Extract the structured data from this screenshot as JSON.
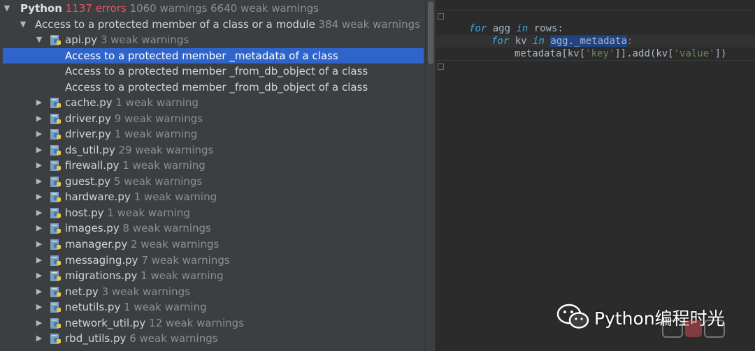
{
  "tree": {
    "root": {
      "label": "Python",
      "errors": "1137 errors",
      "warnings": "1060 warnings",
      "weak": "6640 weak warnings"
    },
    "group": {
      "label": "Access to a protected member of a class or a module",
      "count": "384 weak warnings"
    },
    "api": {
      "name": "api.py",
      "count": "3 weak warnings",
      "items": [
        "Access to a protected member _metadata of a class",
        "Access to a protected member _from_db_object of a class",
        "Access to a protected member _from_db_object of a class"
      ]
    },
    "files": [
      {
        "name": "cache.py",
        "count": "1 weak warning"
      },
      {
        "name": "driver.py",
        "count": "9 weak warnings"
      },
      {
        "name": "driver.py",
        "count": "1 weak warning"
      },
      {
        "name": "ds_util.py",
        "count": "29 weak warnings"
      },
      {
        "name": "firewall.py",
        "count": "1 weak warning"
      },
      {
        "name": "guest.py",
        "count": "5 weak warnings"
      },
      {
        "name": "hardware.py",
        "count": "1 weak warning"
      },
      {
        "name": "host.py",
        "count": "1 weak warning"
      },
      {
        "name": "images.py",
        "count": "8 weak warnings"
      },
      {
        "name": "manager.py",
        "count": "2 weak warnings"
      },
      {
        "name": "messaging.py",
        "count": "7 weak warnings"
      },
      {
        "name": "migrations.py",
        "count": "1 weak warning"
      },
      {
        "name": "net.py",
        "count": "3 weak warnings"
      },
      {
        "name": "netutils.py",
        "count": "1 weak warning"
      },
      {
        "name": "network_util.py",
        "count": "12 weak warnings"
      },
      {
        "name": "rbd_utils.py",
        "count": "6 weak warnings"
      }
    ]
  },
  "editor": {
    "line1": {
      "kw": "for",
      "a": " agg ",
      "in": "in",
      "b": " rows:"
    },
    "line2": {
      "kw": "for",
      "a": " kv ",
      "in": "in",
      "space": " ",
      "sel": "agg._metadata",
      "colon": ":"
    },
    "line3": {
      "a": "metadata[kv[",
      "s1": "'key'",
      "b": "]].add(kv[",
      "s2": "'value'",
      "c": "])"
    }
  },
  "watermark": {
    "text": "Python编程时光"
  },
  "colors": {
    "selection": "#2f65ca",
    "error": "#e6545b",
    "keyword": "#3fa7e0",
    "string": "#6a8759"
  },
  "icons": {
    "expanded": "triangle-down-icon",
    "collapsed": "triangle-right-icon",
    "file": "python-file-icon"
  }
}
